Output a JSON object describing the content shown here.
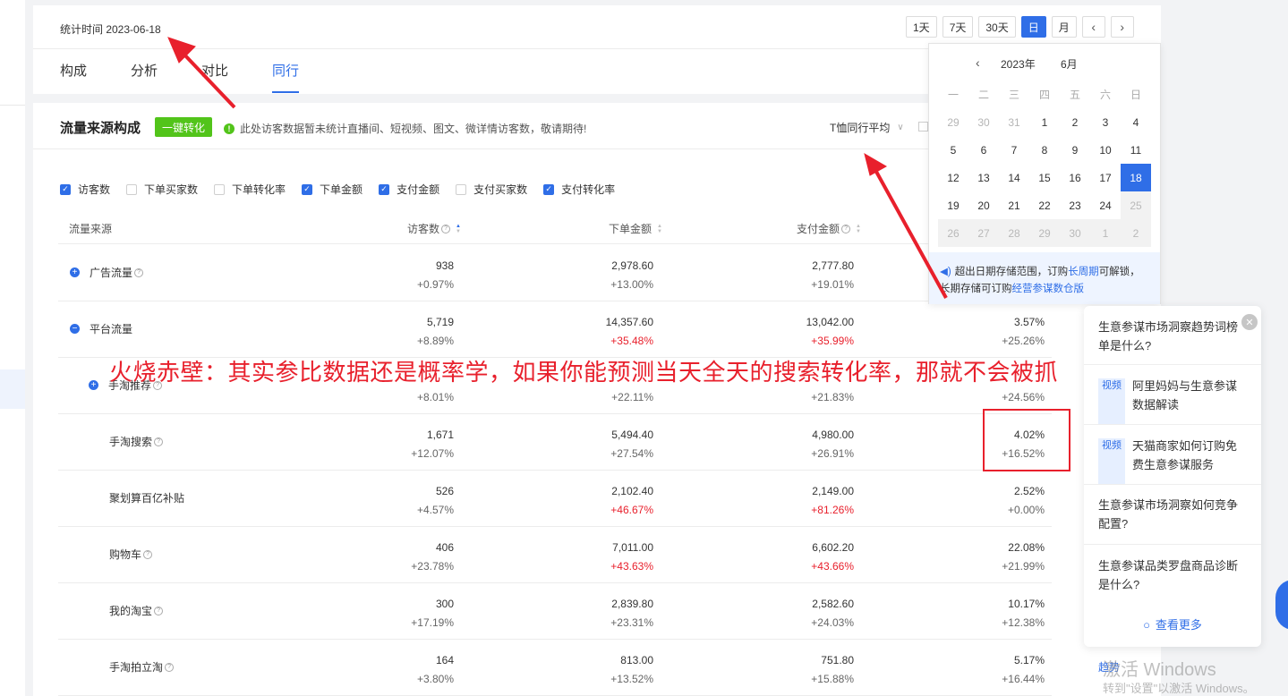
{
  "header": {
    "stat_time": "统计时间 2023-06-18",
    "tabs": [
      {
        "label": "构成"
      },
      {
        "label": "分析"
      },
      {
        "label": "对比"
      },
      {
        "label": "同行"
      }
    ],
    "active_tab": "同行",
    "range_buttons": [
      {
        "label": "1天"
      },
      {
        "label": "7天"
      },
      {
        "label": "30天"
      },
      {
        "label": "日"
      },
      {
        "label": "月"
      }
    ],
    "active_range": "日"
  },
  "section": {
    "title": "流量来源构成",
    "convert_button": "一键转化",
    "notice": "此处访客数据暂未统计直播间、短视频、图文、微详情访客数，敬请期待!",
    "peer_select": "T恤同行平均"
  },
  "metrics": [
    {
      "label": "访客数",
      "checked": true
    },
    {
      "label": "下单买家数",
      "checked": false
    },
    {
      "label": "下单转化率",
      "checked": false
    },
    {
      "label": "下单金额",
      "checked": true
    },
    {
      "label": "支付金额",
      "checked": true
    },
    {
      "label": "支付买家数",
      "checked": false
    },
    {
      "label": "支付转化率",
      "checked": true
    }
  ],
  "table": {
    "headers": [
      "流量来源",
      "访客数",
      "下单金额",
      "支付金额"
    ],
    "rows": [
      {
        "name": "广告流量",
        "expand": "+",
        "help": true,
        "visitors": "938",
        "visitors_change": "+0.97%",
        "order_amount": "2,978.60",
        "order_change": "+13.00%",
        "pay_amount": "2,777.80",
        "pay_change": "+19.01%",
        "rate": "",
        "rate_change": ""
      },
      {
        "name": "平台流量",
        "expand": "−",
        "help": false,
        "visitors": "5,719",
        "visitors_change": "+8.89%",
        "order_amount": "14,357.60",
        "order_change": "+35.48%",
        "pay_amount": "13,042.00",
        "pay_change": "+35.99%",
        "rate": "3.57%",
        "rate_change": "+25.26%"
      },
      {
        "name": "手淘推荐",
        "expand": "+",
        "help": true,
        "visitors": "",
        "visitors_change": "+8.01%",
        "order_amount": "",
        "order_change": "+22.11%",
        "pay_amount": "",
        "pay_change": "+21.83%",
        "rate": "",
        "rate_change": "+24.56%"
      },
      {
        "name": "手淘搜索",
        "expand": "",
        "help": true,
        "visitors": "1,671",
        "visitors_change": "+12.07%",
        "order_amount": "5,494.40",
        "order_change": "+27.54%",
        "pay_amount": "4,980.00",
        "pay_change": "+26.91%",
        "rate": "4.02%",
        "rate_change": "+16.52%"
      },
      {
        "name": "聚划算百亿补贴",
        "expand": "",
        "help": false,
        "visitors": "526",
        "visitors_change": "+4.57%",
        "order_amount": "2,102.40",
        "order_change": "+46.67%",
        "pay_amount": "2,149.00",
        "pay_change": "+81.26%",
        "rate": "2.52%",
        "rate_change": "+0.00%"
      },
      {
        "name": "购物车",
        "expand": "",
        "help": true,
        "visitors": "406",
        "visitors_change": "+23.78%",
        "order_amount": "7,011.00",
        "order_change": "+43.63%",
        "pay_amount": "6,602.20",
        "pay_change": "+43.66%",
        "rate": "22.08%",
        "rate_change": "+21.99%"
      },
      {
        "name": "我的淘宝",
        "expand": "",
        "help": true,
        "visitors": "300",
        "visitors_change": "+17.19%",
        "order_amount": "2,839.80",
        "order_change": "+23.31%",
        "pay_amount": "2,582.60",
        "pay_change": "+24.03%",
        "rate": "10.17%",
        "rate_change": "+12.38%"
      },
      {
        "name": "手淘拍立淘",
        "expand": "",
        "help": true,
        "visitors": "164",
        "visitors_change": "+3.80%",
        "order_amount": "813.00",
        "order_change": "+13.52%",
        "pay_amount": "751.80",
        "pay_change": "+15.88%",
        "rate": "5.17%",
        "rate_change": "+16.44%"
      }
    ]
  },
  "calendar": {
    "year": "2023年",
    "month": "6月",
    "weekdays": [
      "一",
      "二",
      "三",
      "四",
      "五",
      "六",
      "日"
    ],
    "weeks": [
      [
        {
          "d": "29",
          "s": "muted"
        },
        {
          "d": "30",
          "s": "muted"
        },
        {
          "d": "31",
          "s": "muted"
        },
        {
          "d": "1",
          "s": ""
        },
        {
          "d": "2",
          "s": ""
        },
        {
          "d": "3",
          "s": ""
        },
        {
          "d": "4",
          "s": ""
        }
      ],
      [
        {
          "d": "5",
          "s": ""
        },
        {
          "d": "6",
          "s": ""
        },
        {
          "d": "7",
          "s": ""
        },
        {
          "d": "8",
          "s": ""
        },
        {
          "d": "9",
          "s": ""
        },
        {
          "d": "10",
          "s": ""
        },
        {
          "d": "11",
          "s": ""
        }
      ],
      [
        {
          "d": "12",
          "s": ""
        },
        {
          "d": "13",
          "s": ""
        },
        {
          "d": "14",
          "s": ""
        },
        {
          "d": "15",
          "s": ""
        },
        {
          "d": "16",
          "s": ""
        },
        {
          "d": "17",
          "s": ""
        },
        {
          "d": "18",
          "s": "sel"
        }
      ],
      [
        {
          "d": "19",
          "s": ""
        },
        {
          "d": "20",
          "s": ""
        },
        {
          "d": "21",
          "s": ""
        },
        {
          "d": "22",
          "s": ""
        },
        {
          "d": "23",
          "s": ""
        },
        {
          "d": "24",
          "s": ""
        },
        {
          "d": "25",
          "s": "disabled"
        }
      ],
      [
        {
          "d": "26",
          "s": "disabled"
        },
        {
          "d": "27",
          "s": "disabled"
        },
        {
          "d": "28",
          "s": "disabled"
        },
        {
          "d": "29",
          "s": "disabled"
        },
        {
          "d": "30",
          "s": "disabled"
        },
        {
          "d": "1",
          "s": "disabled"
        },
        {
          "d": "2",
          "s": "disabled"
        }
      ]
    ],
    "footer_line1_a": "超出日期存储范围，订购",
    "footer_link1": "长周期",
    "footer_line1_b": "可解锁，",
    "footer_line2_a": "长期存储可订购",
    "footer_link2": "经营参谋数仓版"
  },
  "help_panel": {
    "items": [
      {
        "type": "text",
        "text": "生意参谋市场洞察趋势词榜单是什么?"
      },
      {
        "type": "video",
        "tag": "视频",
        "text": "阿里妈妈与生意参谋数据解读"
      },
      {
        "type": "video",
        "tag": "视频",
        "text": "天猫商家如何订购免费生意参谋服务"
      },
      {
        "type": "text",
        "text": "生意参谋市场洞察如何竞争配置?"
      },
      {
        "type": "text",
        "text": "生意参谋品类罗盘商品诊断是什么?"
      }
    ],
    "more": "查看更多"
  },
  "trend_link": "趋势",
  "annotation": "火烧赤壁：其实参比数据还是概率学，如果你能预测当天全天的搜索转化率，那就不会被抓",
  "watermark": {
    "line1": "激活 Windows",
    "line2": "转到\"设置\"以激活 Windows。"
  },
  "colors": {
    "accent": "#2f6ee7",
    "positive_red": "#e8202c",
    "convert_green": "#52c41a",
    "annotation_red": "#e8202c"
  }
}
